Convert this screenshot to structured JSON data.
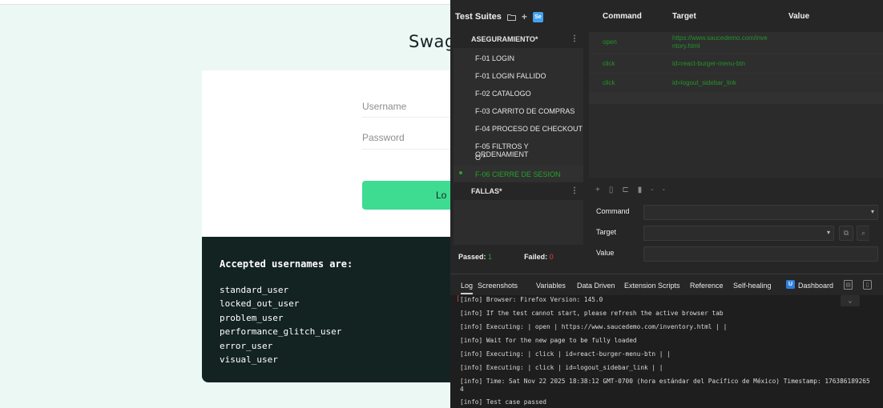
{
  "background_page": {
    "title": "Swag",
    "username_placeholder": "Username",
    "password_placeholder": "Password",
    "login_label": "Lo",
    "credentials_heading": "Accepted usernames are:",
    "usernames": [
      "standard_user",
      "locked_out_user",
      "problem_user",
      "performance_glitch_user",
      "error_user",
      "visual_user"
    ]
  },
  "ide": {
    "suites_title": "Test Suites",
    "suites_icons": [
      "folder-icon",
      "plus-icon",
      "selenium-badge-icon"
    ],
    "selenium_badge": "Se",
    "groups": [
      {
        "name": "ASEGURAMIENTO*",
        "tests": [
          "F-01 LOGIN",
          "F-01 LOGIN FALLIDO",
          "F-02 CATALOGO",
          "F-03 CARRITO DE COMPRAS",
          "F-04 PROCESO DE CHECKOUT",
          "F-05 FILTROS Y ORDENAMIENT",
          "O *",
          "F-06 CIERRE DE SESION"
        ]
      },
      {
        "name": "FALLAS*",
        "tests": []
      }
    ],
    "selected_test": "F-06 CIERRE DE SESION",
    "menu_dots": "⋮",
    "passed_label": "Passed:",
    "passed_count": "1",
    "failed_label": "Failed:",
    "failed_count": "0",
    "table_headers": {
      "command": "Command",
      "target": "Target",
      "value": "Value"
    },
    "commands": [
      {
        "command": "open",
        "target": "https://www.saucedemo.com/inventory.html",
        "value": ""
      },
      {
        "command": "click",
        "target": "id=react-burger-menu-btn",
        "value": ""
      },
      {
        "command": "click",
        "target": "id=logout_sidebar_link",
        "value": ""
      }
    ],
    "command_target_lines": [
      "https://www.saucedemo.com/inve",
      "ntory.html"
    ],
    "editor": {
      "command_label": "Command",
      "target_label": "Target",
      "value_label": "Value"
    },
    "log_tabs": [
      "Log",
      "Screenshots",
      "Variables",
      "Data Driven",
      "Extension Scripts",
      "Reference",
      "Self-healing",
      "Dashboard"
    ],
    "active_log_tab": "Log",
    "dashboard_badge": "U",
    "log_lines": [
      "[info] Browser: Firefox Version: 145.0",
      "[info] If the test cannot start, please refresh the active browser tab",
      "[info] Executing: | open | https://www.saucedemo.com/inventory.html | |",
      "[info] Wait for the new page to be fully loaded",
      "[info] Executing: | click | id=react-burger-menu-btn | |",
      "[info] Executing: | click | id=logout_sidebar_link | |",
      "[info] Time: Sat Nov 22 2025 18:38:12 GMT-0700 (hora estándar del Pacífico de México) Timestamp: 176386189265",
      "4",
      "[info] Test case passed"
    ]
  },
  "colors": {
    "accent_green": "#3ddc91",
    "pass_green": "#27a32a",
    "fail_red": "#e24040",
    "ide_bg": "#262626",
    "creds_bg": "#132322"
  }
}
